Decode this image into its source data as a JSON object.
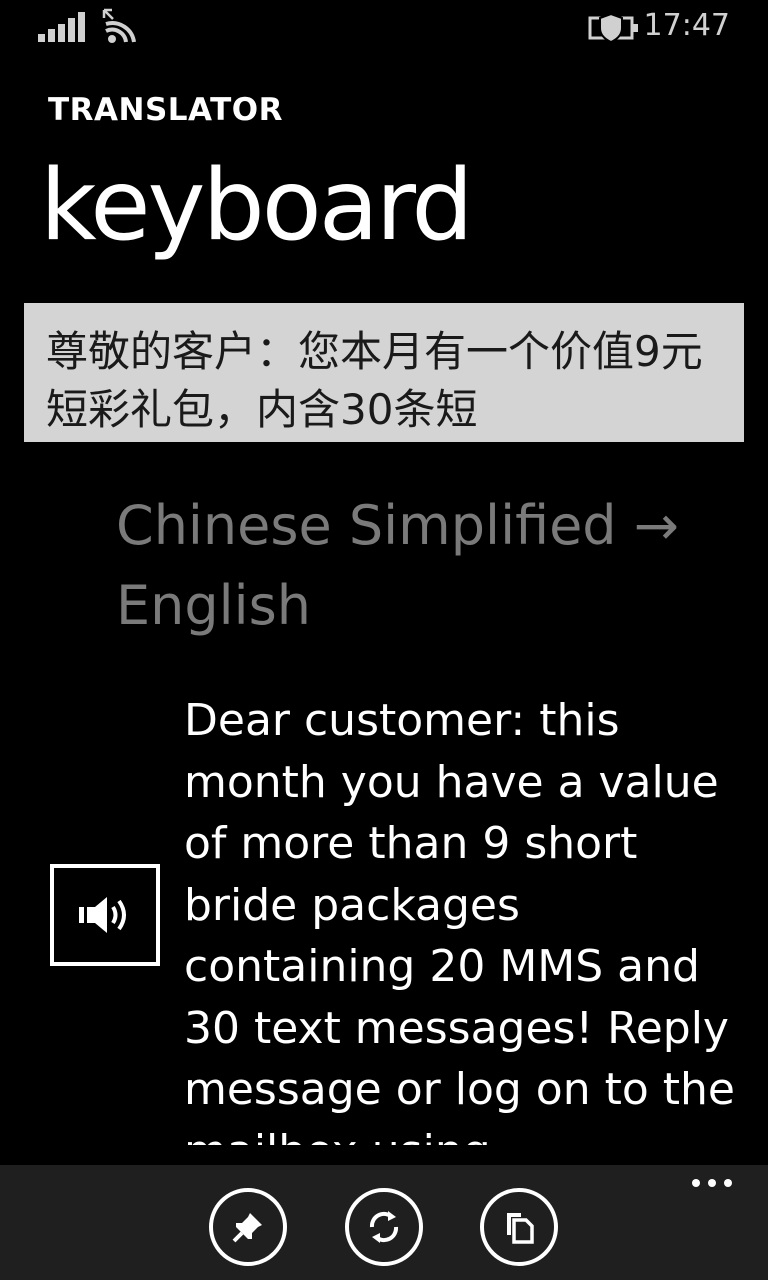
{
  "status_bar": {
    "signal_icon": "signal-bars-icon",
    "wifi_icon": "wifi-icon",
    "battery_icon": "battery-saver-icon",
    "time": "17:47"
  },
  "app": {
    "title": "TRANSLATOR",
    "page_title": "keyboard"
  },
  "source": {
    "text": "尊敬的客户：您本月有一个价值9元短彩礼包，内含30条短"
  },
  "language_pair": {
    "label": "Chinese Simplified → English"
  },
  "translation": {
    "text": "Dear customer: this month you have a value of more than 9 short bride packages containing 20 MMS and 30 text messages! Reply message or log on to the mailbox using"
  },
  "speak_button": {
    "icon": "speaker-icon"
  },
  "app_bar": {
    "buttons": [
      {
        "icon": "pin-icon"
      },
      {
        "icon": "swap-icon"
      },
      {
        "icon": "copy-icon"
      }
    ],
    "more_icon": "more-ellipsis-icon"
  }
}
